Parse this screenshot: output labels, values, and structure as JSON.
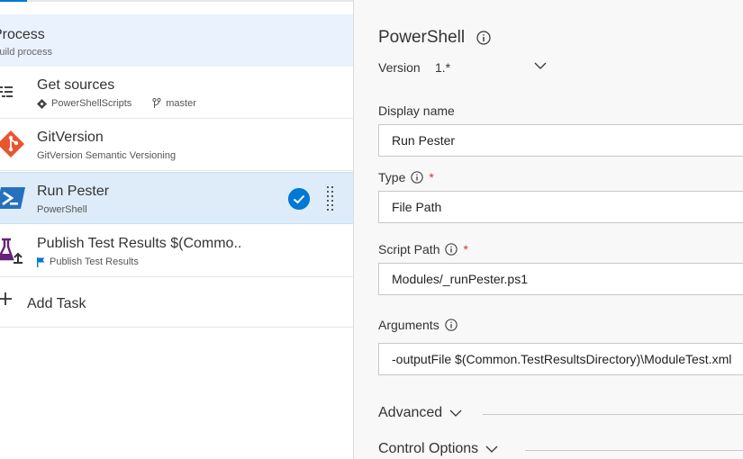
{
  "process": {
    "title": "Process",
    "subtitle": "Build process"
  },
  "tasks": [
    {
      "name": "Get sources",
      "repo": "PowerShellScripts",
      "branch": "master"
    },
    {
      "name": "GitVersion",
      "subtitle": "GitVersion Semantic Versioning"
    },
    {
      "name": "Run Pester",
      "subtitle": "PowerShell"
    },
    {
      "name": "Publish Test Results $(Commo..",
      "subtitle": "Publish Test Results"
    }
  ],
  "add_task": {
    "label": "Add Task"
  },
  "panel": {
    "title": "PowerShell",
    "version_label": "Version",
    "version_value": "1.*",
    "display_name": {
      "label": "Display name",
      "value": "Run Pester"
    },
    "type": {
      "label": "Type",
      "value": "File Path",
      "required": "*"
    },
    "script_path": {
      "label": "Script Path",
      "value": "Modules/_runPester.ps1",
      "required": "*"
    },
    "arguments": {
      "label": "Arguments",
      "value": "-outputFile $(Common.TestResultsDirectory)\\ModuleTest.xml"
    },
    "advanced": "Advanced",
    "control_options": "Control Options"
  },
  "colors": {
    "accent": "#0078d4",
    "selected_bg": "#deecf9",
    "required": "#d13438",
    "gitversion": "#e8552f",
    "publish": "#68217a"
  },
  "icons": {
    "get_sources": "list-icon",
    "gitversion": "git-diamond-icon",
    "run_pester": "powershell-icon",
    "publish": "flask-upload-icon",
    "selected": "checkmark-icon",
    "drag": "drag-handle-icon",
    "add": "plus-icon",
    "info": "info-icon",
    "chevron": "chevron-down-icon"
  }
}
